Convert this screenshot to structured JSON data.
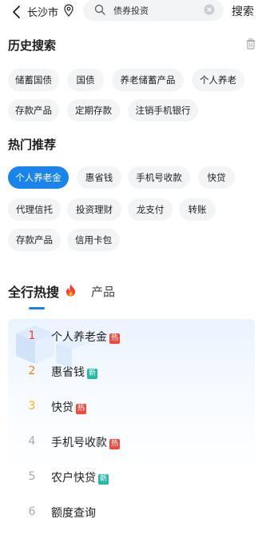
{
  "top": {
    "city": "长沙市",
    "search_value": "债券投资",
    "search_button": "搜索"
  },
  "history": {
    "title": "历史搜索",
    "items": [
      "储蓄国债",
      "国债",
      "养老储蓄产品",
      "个人养老",
      "存款产品",
      "定期存款",
      "注销手机银行"
    ]
  },
  "hot_recommend": {
    "title": "热门推荐",
    "items": [
      "个人养老金",
      "惠省钱",
      "手机号收款",
      "快贷",
      "代理信托",
      "投资理财",
      "龙支付",
      "转账",
      "存款产品",
      "信用卡包"
    ],
    "active_index": 0
  },
  "tabs": {
    "main": "全行热搜",
    "product": "产品"
  },
  "hot_list": [
    {
      "rank": "1",
      "text": "个人养老金",
      "badge": "热"
    },
    {
      "rank": "2",
      "text": "惠省钱",
      "badge": "新"
    },
    {
      "rank": "3",
      "text": "快贷",
      "badge": "热"
    },
    {
      "rank": "4",
      "text": "手机号收款",
      "badge": "热"
    },
    {
      "rank": "5",
      "text": "农户快贷",
      "badge": "新"
    },
    {
      "rank": "6",
      "text": "额度查询",
      "badge": ""
    }
  ],
  "colors": {
    "accent": "#1b84ec",
    "hot_badge": "#ef4b40",
    "new_badge": "#25b9a8",
    "rank1": "#ef3b32",
    "rank2": "#f27b28",
    "rank3": "#f5b517"
  },
  "icons": {
    "back": "chevron-left-icon",
    "location": "location-pin-icon",
    "search": "search-icon",
    "clear": "clear-icon",
    "delete": "trash-icon",
    "fire": "fire-icon"
  }
}
